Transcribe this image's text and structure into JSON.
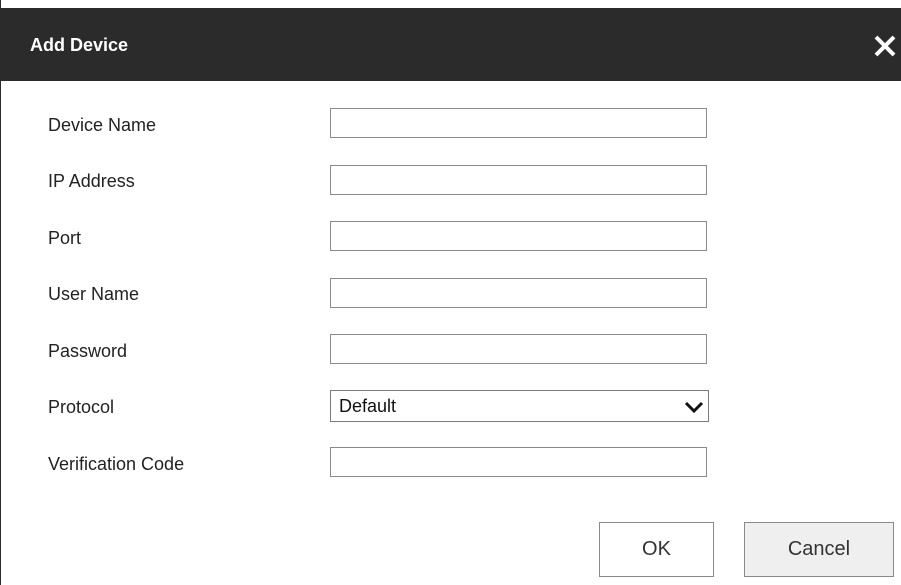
{
  "dialog": {
    "title": "Add Device",
    "close_icon": "close-icon"
  },
  "form": {
    "fields": [
      {
        "label": "Device Name",
        "value": ""
      },
      {
        "label": "IP Address",
        "value": ""
      },
      {
        "label": "Port",
        "value": ""
      },
      {
        "label": "User Name",
        "value": ""
      },
      {
        "label": "Password",
        "value": ""
      },
      {
        "label": "Protocol",
        "value": "Default",
        "type": "select"
      },
      {
        "label": "Verification Code",
        "value": ""
      }
    ]
  },
  "buttons": {
    "ok_label": "OK",
    "cancel_label": "Cancel"
  },
  "colors": {
    "titlebar": "#2b2b2b",
    "title_text": "#ffffff",
    "cancel_bg": "#efefef"
  }
}
